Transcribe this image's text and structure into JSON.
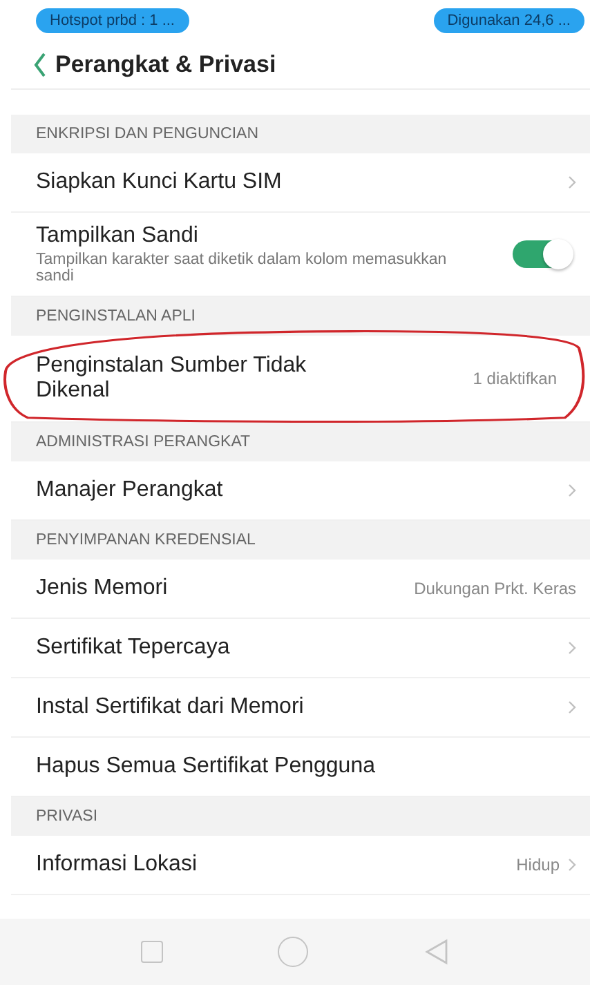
{
  "status_bar": {
    "left_pill": "Hotspot prbd : 1 ...",
    "right_pill": "Digunakan 24,6 ..."
  },
  "header": {
    "title": "Perangkat & Privasi"
  },
  "sections": [
    {
      "title": "ENKRIPSI DAN PENGUNCIAN",
      "rows": [
        {
          "kind": "link",
          "title": "Siapkan Kunci Kartu SIM",
          "chevron": true
        },
        {
          "kind": "switch",
          "title": "Tampilkan Sandi",
          "subtitle": "Tampilkan karakter saat diketik dalam kolom memasukkan sandi",
          "on": true
        }
      ]
    },
    {
      "title": "PENGINSTALAN APLI",
      "circled": true,
      "rows": [
        {
          "kind": "link",
          "title": "Penginstalan Sumber Tidak Dikenal",
          "value": "1 diaktifkan",
          "chevron": false
        }
      ]
    },
    {
      "title": "ADMINISTRASI PERANGKAT",
      "rows": [
        {
          "kind": "link",
          "title": "Manajer Perangkat",
          "chevron": true
        }
      ]
    },
    {
      "title": "PENYIMPANAN KREDENSIAL",
      "rows": [
        {
          "kind": "link",
          "title": "Jenis Memori",
          "value": "Dukungan Prkt. Keras",
          "chevron": false
        },
        {
          "kind": "link",
          "title": "Sertifikat Tepercaya",
          "chevron": true
        },
        {
          "kind": "link",
          "title": "Instal Sertifikat dari Memori",
          "chevron": true
        },
        {
          "kind": "link",
          "title": "Hapus Semua Sertifikat Pengguna",
          "chevron": false
        }
      ]
    },
    {
      "title": "PRIVASI",
      "rows": [
        {
          "kind": "link",
          "title": "Informasi Lokasi",
          "value": "Hidup",
          "chevron": true
        }
      ]
    }
  ]
}
